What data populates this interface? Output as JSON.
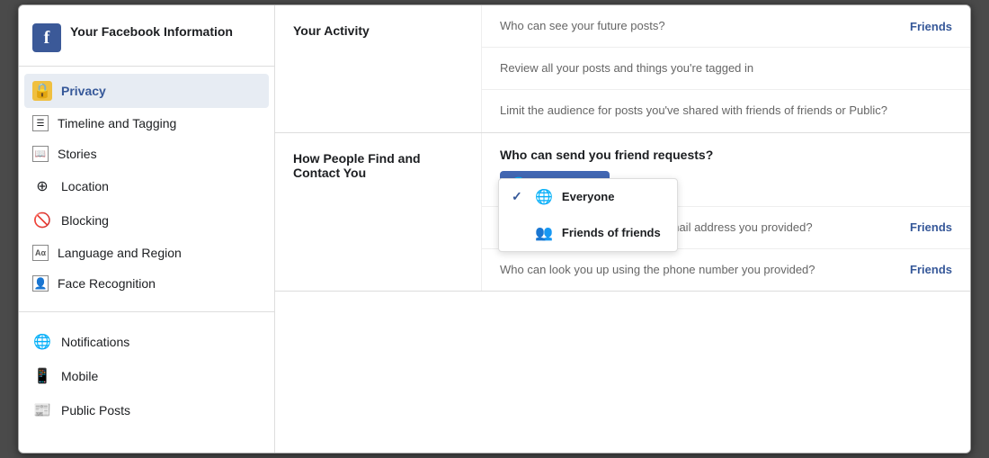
{
  "sidebar": {
    "header": {
      "title": "Your Facebook Information",
      "fb_letter": "f"
    },
    "items": [
      {
        "id": "privacy",
        "label": "Privacy",
        "icon": "🔒",
        "active": true,
        "icon_type": "lock"
      },
      {
        "id": "timeline",
        "label": "Timeline and Tagging",
        "icon": "☰",
        "active": false,
        "icon_type": "list"
      },
      {
        "id": "stories",
        "label": "Stories",
        "icon": "📖",
        "active": false,
        "icon_type": "book"
      },
      {
        "id": "location",
        "label": "Location",
        "icon": "📍",
        "active": false,
        "icon_type": "pin"
      },
      {
        "id": "blocking",
        "label": "Blocking",
        "icon": "🚫",
        "active": false,
        "icon_type": "block"
      },
      {
        "id": "language",
        "label": "Language and Region",
        "icon": "🔤",
        "active": false,
        "icon_type": "text"
      },
      {
        "id": "face",
        "label": "Face Recognition",
        "icon": "👤",
        "active": false,
        "icon_type": "person"
      }
    ],
    "items2": [
      {
        "id": "notifications",
        "label": "Notifications",
        "icon": "🌐",
        "active": false
      },
      {
        "id": "mobile",
        "label": "Mobile",
        "icon": "📱",
        "active": false
      },
      {
        "id": "public_posts",
        "label": "Public Posts",
        "icon": "📰",
        "active": false
      }
    ]
  },
  "main": {
    "your_activity": {
      "section_label": "Your Activity",
      "rows": [
        {
          "text": "Who can see your future posts?",
          "value": "Friends"
        },
        {
          "text": "Review all your posts and things you're tagged in",
          "value": ""
        },
        {
          "text": "Limit the audience for posts you've shared with friends of friends or Public?",
          "value": ""
        }
      ]
    },
    "how_people_find": {
      "section_label": "How People Find and Contact You",
      "header": "Who can send you friend requests?",
      "dropdown_label": "Everyone",
      "dropdown_options": [
        {
          "label": "Everyone",
          "selected": true
        },
        {
          "label": "Friends of friends",
          "selected": false
        }
      ],
      "rows": [
        {
          "text": "Who can look you up using the email address you provided?",
          "value": "Friends"
        },
        {
          "text": "Who can look you up using the phone number you provided?",
          "value": "Friends"
        }
      ]
    }
  }
}
